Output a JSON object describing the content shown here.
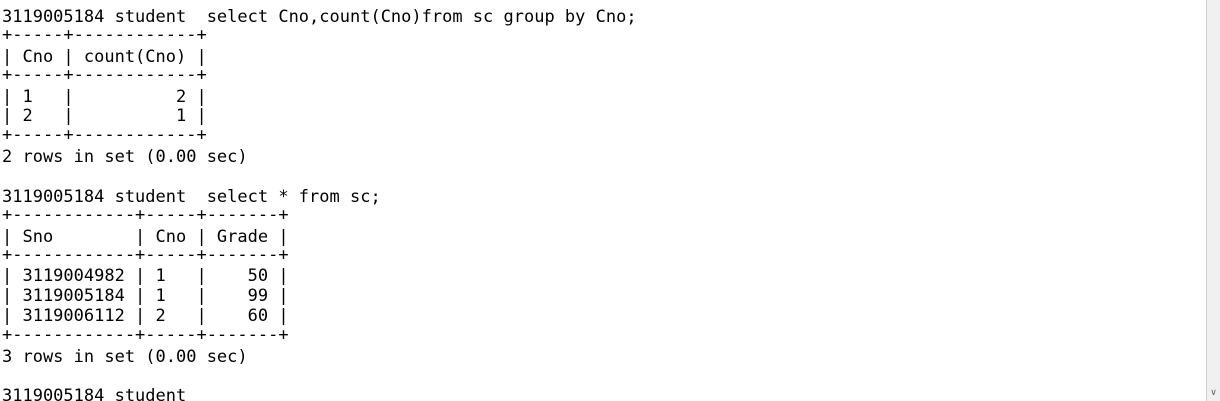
{
  "console": {
    "lines": [
      "3119005184 student  select Cno,count(Cno)from sc group by Cno;",
      "+-----+------------+",
      "| Cno | count(Cno) |",
      "+-----+------------+",
      "| 1   |          2 |",
      "| 2   |          1 |",
      "+-----+------------+",
      "2 rows in set (0.00 sec)",
      "",
      "3119005184 student  select * from sc;",
      "+------------+-----+-------+",
      "| Sno        | Cno | Grade |",
      "+------------+-----+-------+",
      "| 3119004982 | 1   |    50 |",
      "| 3119005184 | 1   |    99 |",
      "| 3119006112 | 2   |    60 |",
      "+------------+-----+-------+",
      "3 rows in set (0.00 sec)",
      "",
      "3119005184 student"
    ]
  },
  "scrollbar": {
    "down_arrow_glyph": "∨",
    "down_arrow_icon": "chevron-down-icon"
  }
}
